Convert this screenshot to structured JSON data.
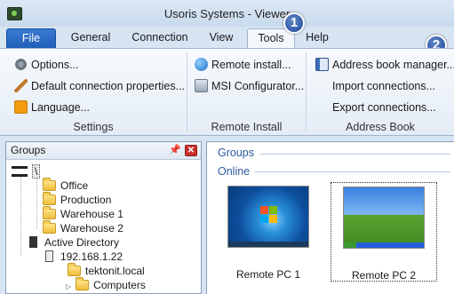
{
  "window": {
    "title": "Usoris Systems - Viewer"
  },
  "tabs": [
    {
      "label": "File"
    },
    {
      "label": "General"
    },
    {
      "label": "Connection"
    },
    {
      "label": "View"
    },
    {
      "label": "Tools"
    },
    {
      "label": "Help"
    }
  ],
  "badges": [
    "1",
    "2"
  ],
  "ribbon": {
    "settings": {
      "label": "Settings",
      "items": [
        "Options...",
        "Default connection properties...",
        "Language..."
      ]
    },
    "remote_install": {
      "label": "Remote Install",
      "items": [
        "Remote install...",
        "MSI Configurator..."
      ]
    },
    "address_book": {
      "label": "Address Book",
      "items": [
        "Address book manager...",
        "Import connections...",
        "Export connections..."
      ]
    }
  },
  "left_panel": {
    "title": "Groups",
    "tree": [
      {
        "label": "\\"
      },
      {
        "label": "Office"
      },
      {
        "label": "Production"
      },
      {
        "label": "Warehouse 1"
      },
      {
        "label": "Warehouse 2"
      },
      {
        "label": "Active Directory"
      },
      {
        "label": "192.168.1.22"
      },
      {
        "label": "tektonit.local"
      },
      {
        "label": "Computers"
      }
    ]
  },
  "right_panel": {
    "groups_label": "Groups",
    "online_label": "Online",
    "computers": [
      {
        "name": "Remote PC 1"
      },
      {
        "name": "Remote PC 2"
      }
    ]
  }
}
